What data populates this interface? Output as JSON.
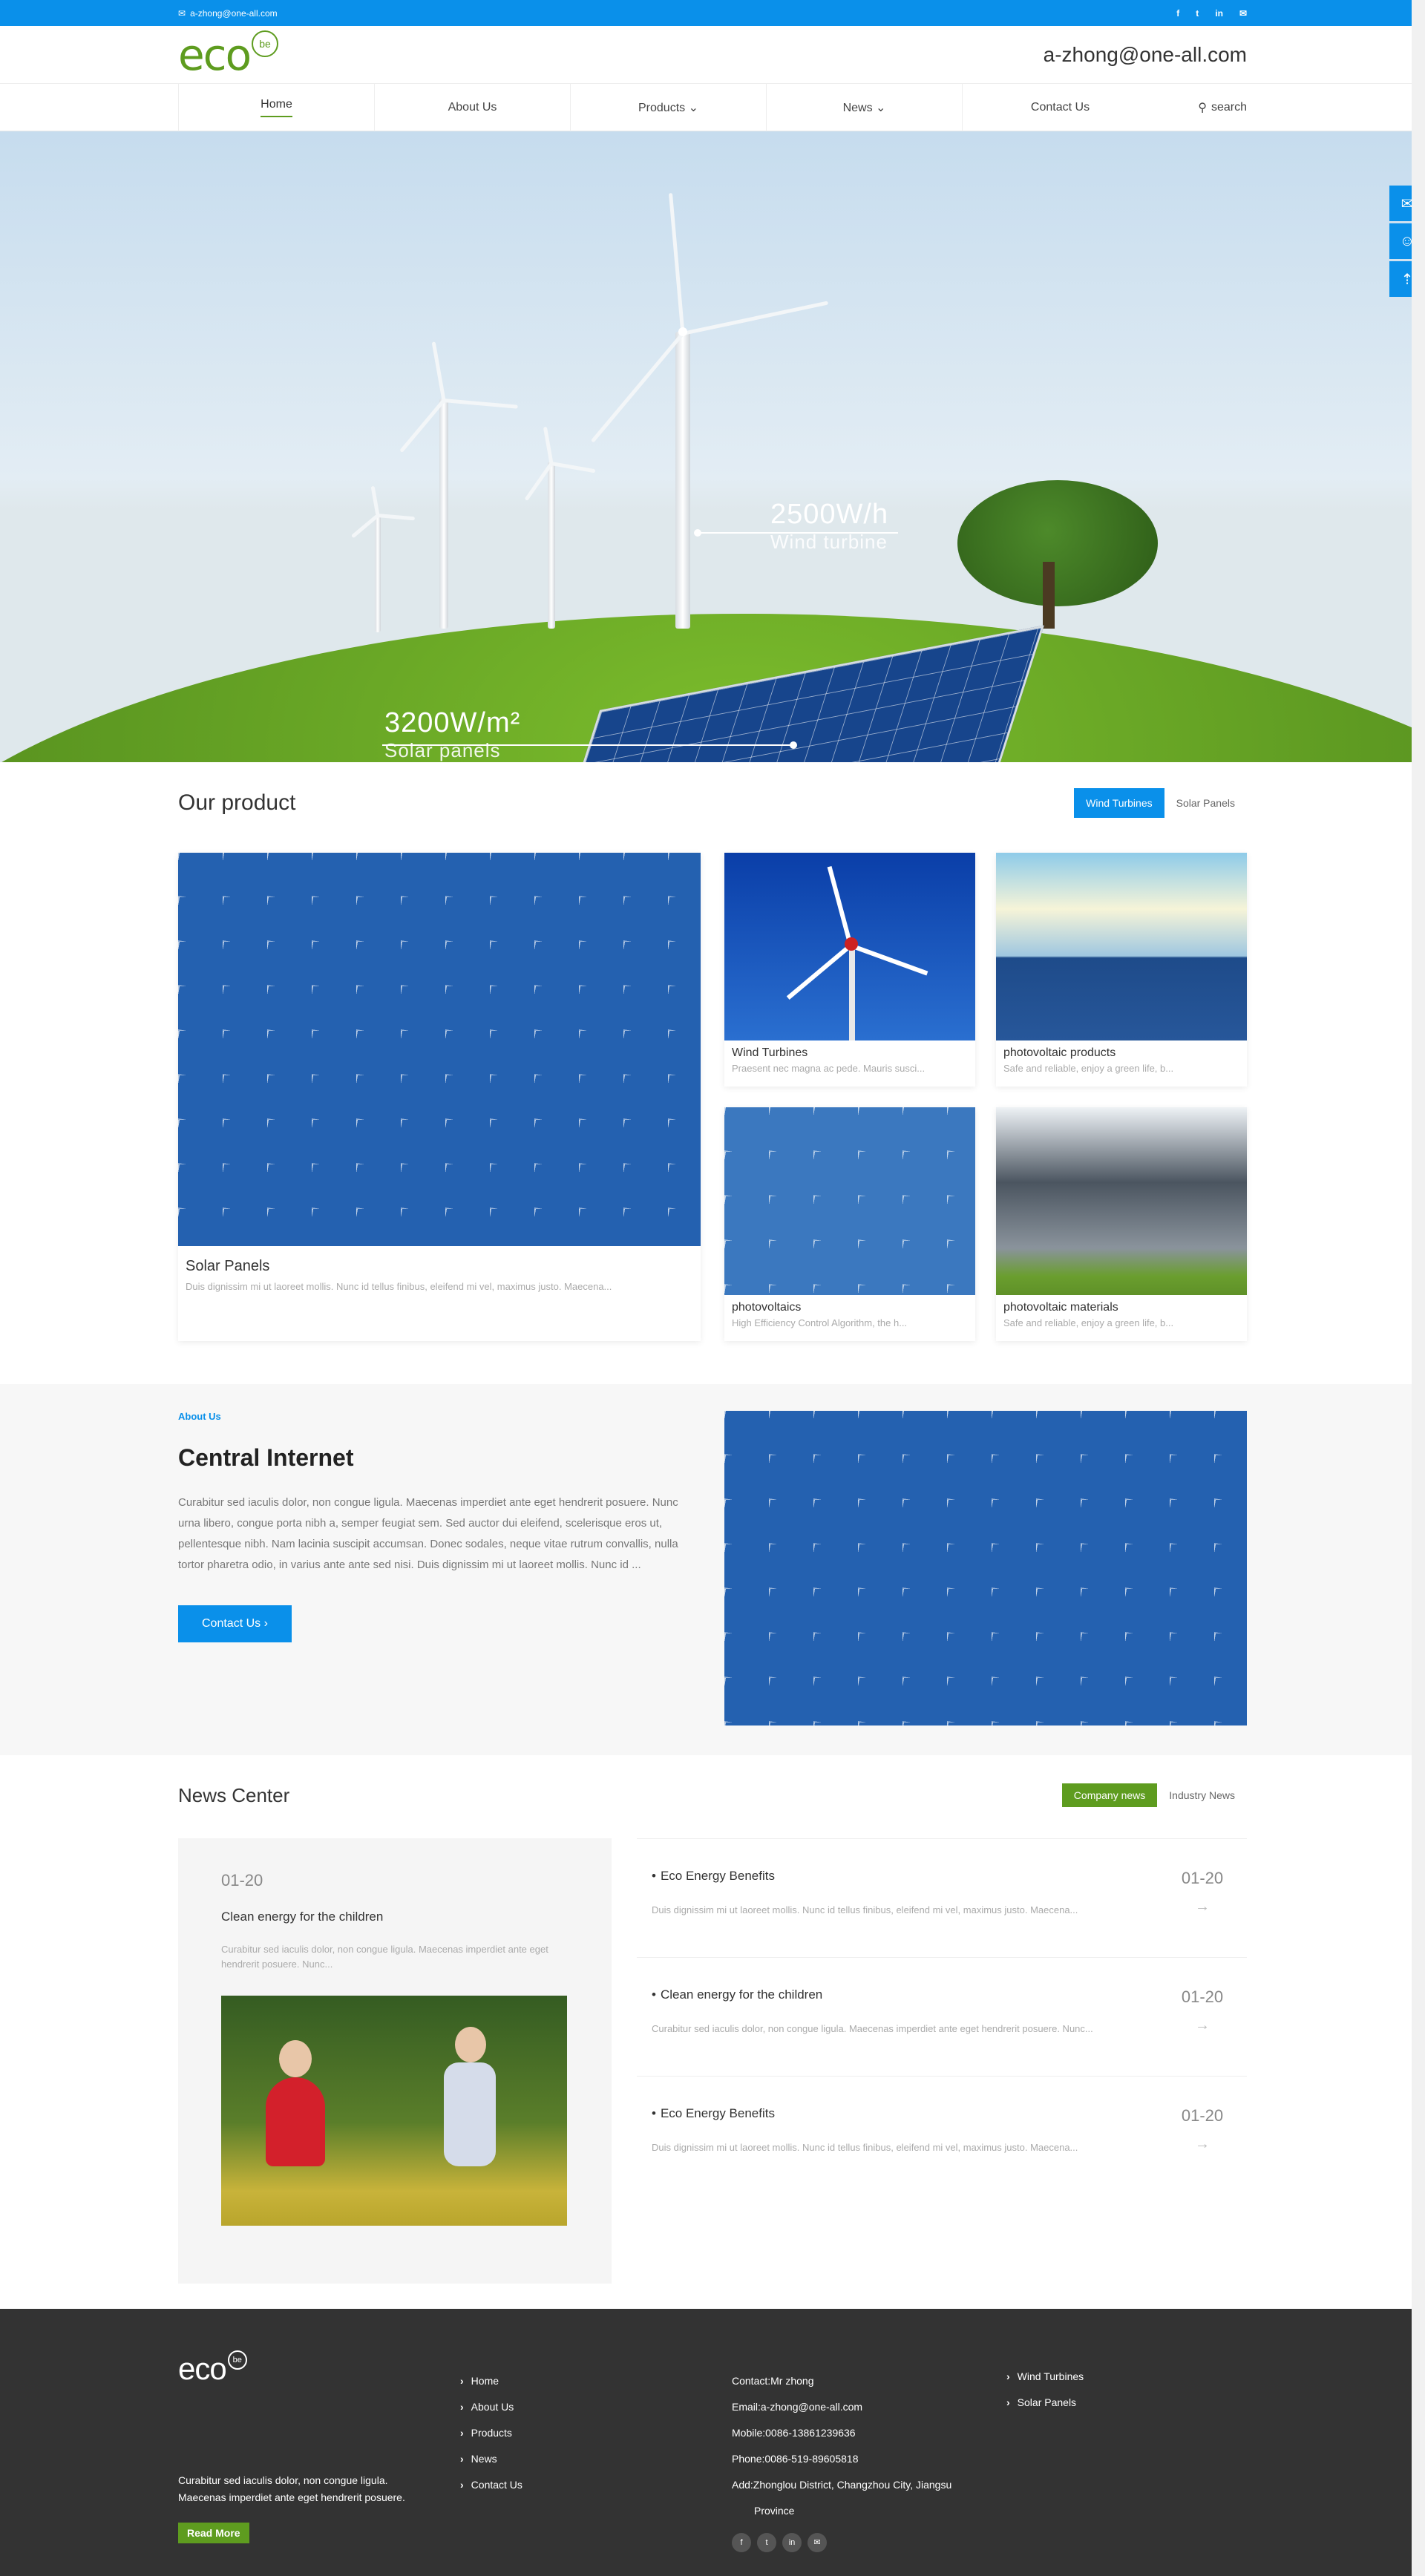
{
  "topbar": {
    "email": "a-zhong@one-all.com",
    "social": [
      "f",
      "t",
      "in",
      "✉"
    ]
  },
  "header": {
    "logo_text": "eco",
    "logo_badge": "be",
    "contact_email": "a-zhong@one-all.com"
  },
  "nav": {
    "items": [
      "Home",
      "About Us",
      "Products ⌄",
      "News ⌄",
      "Contact Us"
    ],
    "search": "search"
  },
  "hero": {
    "wind_value": "2500W/h",
    "wind_label": "Wind turbine",
    "solar_value": "3200W/m²",
    "solar_label": "Solar panels"
  },
  "side_tools": [
    "mail-icon",
    "user-icon",
    "top-icon"
  ],
  "products": {
    "title": "Our product",
    "tabs": [
      "Wind Turbines",
      "Solar Panels"
    ],
    "featured": {
      "name": "Solar Panels",
      "desc": "Duis dignissim mi ut laoreet mollis. Nunc id tellus finibus, eleifend mi vel, maximus justo. Maecena..."
    },
    "items": [
      {
        "name": "Wind Turbines",
        "desc": "Praesent nec magna ac pede. Mauris susci..."
      },
      {
        "name": "photovoltaic products",
        "desc": "Safe and reliable, enjoy a green life, b..."
      },
      {
        "name": "photovoltaics",
        "desc": "High Efficiency Control Algorithm, the h..."
      },
      {
        "name": "photovoltaic materials",
        "desc": "Safe and reliable, enjoy a green life, b..."
      }
    ]
  },
  "about": {
    "kicker": "About Us",
    "title": "Central Internet",
    "text": "Curabitur sed iaculis dolor, non congue ligula. Maecenas imperdiet ante eget hendrerit posuere. Nunc urna libero, congue porta nibh a, semper feugiat sem. Sed auctor dui eleifend, scelerisque eros ut, pellentesque nibh. Nam lacinia suscipit accumsan. Donec sodales, neque vitae rutrum convallis, nulla tortor pharetra odio, in varius ante ante sed nisi. Duis dignissim mi ut laoreet mollis. Nunc id ...",
    "button": "Contact Us  ›"
  },
  "news": {
    "title": "News Center",
    "tabs": [
      "Company news",
      "Industry News"
    ],
    "featured": {
      "date": "01-20",
      "title": "Clean energy for the children",
      "text": "Curabitur sed iaculis dolor, non congue ligula. Maecenas imperdiet ante eget hendrerit posuere. Nunc..."
    },
    "items": [
      {
        "title": "Eco Energy Benefits",
        "text": "Duis dignissim mi ut laoreet mollis. Nunc id tellus finibus, eleifend mi vel, maximus justo. Maecena...",
        "date": "01-20",
        "arrow": "→"
      },
      {
        "title": "Clean energy for the children",
        "text": "Curabitur sed iaculis dolor, non congue ligula. Maecenas imperdiet ante eget hendrerit posuere. Nunc...",
        "date": "01-20",
        "arrow": "→"
      },
      {
        "title": "Eco Energy Benefits",
        "text": "Duis dignissim mi ut laoreet mollis. Nunc id tellus finibus, eleifend mi vel, maximus justo. Maecena...",
        "date": "01-20",
        "arrow": "→"
      }
    ]
  },
  "footer": {
    "logo_text": "eco",
    "logo_badge": "be",
    "text": "Curabitur sed iaculis dolor, non congue ligula. Maecenas imperdiet ante eget hendrerit posuere.",
    "button": "Read More",
    "links": [
      "Home",
      "About Us",
      "Products",
      "News",
      "Contact Us"
    ],
    "contact": [
      "Contact:Mr zhong",
      "Email:a-zhong@one-all.com",
      "Mobile:0086-13861239636",
      "Phone:0086-519-89605818",
      "Add:Zhonglou District, Changzhou City, Jiangsu",
      "Province"
    ],
    "social": [
      "f",
      "t",
      "in",
      "✉"
    ],
    "products": [
      "Wind Turbines",
      "Solar Panels"
    ]
  },
  "colors": {
    "primary": "#0a90ea",
    "green": "#5e9c1f",
    "footer_bg": "#333333"
  }
}
